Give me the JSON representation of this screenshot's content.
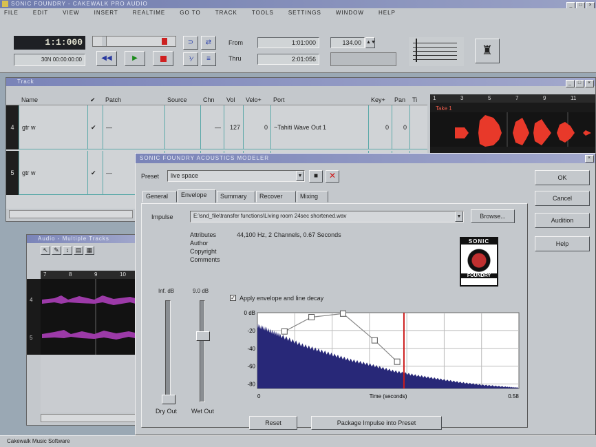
{
  "app": {
    "title": "SONIC FOUNDRY - CAKEWALK PRO AUDIO",
    "menu": [
      "File",
      "Edit",
      "View",
      "Insert",
      "Realtime",
      "Go To",
      "Track",
      "Tools",
      "Settings",
      "Window",
      "Help"
    ]
  },
  "transport": {
    "now_time": "1:1:000",
    "smpte": "30N  00:00:00:00",
    "from_label": "From",
    "from_value": "1:01:000",
    "thru_label": "Thru",
    "thru_value": "2:01:056",
    "tempo": "134.00"
  },
  "track_view": {
    "title": "Track",
    "columns": [
      "Name",
      "✔",
      "Patch",
      "Source",
      "Chn",
      "Vol",
      "Velo+",
      "Port",
      "Key+",
      "Pan",
      "Ti"
    ],
    "rows": [
      {
        "num": "4",
        "name": "gtr w",
        "check": "✔",
        "patch": "—",
        "chn": "—",
        "vol": "127",
        "velo": "0",
        "port": "~Tahiti Wave Out 1",
        "key": "0",
        "pan": "0"
      },
      {
        "num": "5",
        "name": "gtr w",
        "check": "✔",
        "patch": "—",
        "chn": "",
        "vol": "",
        "velo": "",
        "port": "",
        "key": "",
        "pan": ""
      }
    ],
    "clip_label": "Take 1",
    "ruler": [
      "1",
      "3",
      "5",
      "7",
      "9",
      "11"
    ]
  },
  "audio_view": {
    "title": "Audio - Multiple Tracks",
    "ruler": [
      "7",
      "8",
      "9",
      "10"
    ],
    "track_labels": [
      "4",
      "5"
    ]
  },
  "dialog": {
    "title": "Sonic Foundry Acoustics Modeler",
    "preset_label": "Preset",
    "preset_value": "live space",
    "tabs": [
      "General",
      "Envelope",
      "Summary",
      "Recover",
      "Mixing"
    ],
    "active_tab": "Envelope",
    "impulse_label": "Impulse",
    "impulse_path": "E:\\snd_file\\transfer functions\\Living room 24sec shortened.wav",
    "browse": "Browse...",
    "attributes_label": "Attributes",
    "attributes_value": "44,100 Hz, 2 Channels, 0.67 Seconds",
    "author_label": "Author",
    "copyright_label": "Copyright",
    "comments_label": "Comments",
    "dry_db": "Inf. dB",
    "wet_db": "9.0 dB",
    "dry_label": "Dry Out",
    "wet_label": "Wet Out",
    "apply_label": "Apply envelope and line decay",
    "apply_checked": true,
    "reset": "Reset",
    "package": "Package Impulse into Preset",
    "ok": "OK",
    "cancel": "Cancel",
    "audition": "Audition",
    "help": "Help",
    "logo_top": "SONIC",
    "logo_bottom": "FOUNDRY"
  },
  "chart_data": {
    "type": "area",
    "title": "",
    "xlabel": "Time (seconds)",
    "ylabel": "",
    "x_tick_labels": [
      "0",
      "0.58"
    ],
    "y_tick_labels": [
      "0 dB",
      "-20",
      "-40",
      "-60",
      "-80"
    ],
    "xlim": [
      0,
      0.58
    ],
    "ylim": [
      -85,
      0
    ],
    "grid": true,
    "colors": {
      "waveform": "#282878",
      "envelope": "#888888",
      "marker": "#cc1c1c"
    },
    "waveform_envelope_db": [
      {
        "x": 0.0,
        "y": -14
      },
      {
        "x": 0.02,
        "y": -18
      },
      {
        "x": 0.05,
        "y": -25
      },
      {
        "x": 0.1,
        "y": -36
      },
      {
        "x": 0.15,
        "y": -44
      },
      {
        "x": 0.2,
        "y": -52
      },
      {
        "x": 0.25,
        "y": -58
      },
      {
        "x": 0.3,
        "y": -65
      },
      {
        "x": 0.35,
        "y": -70
      },
      {
        "x": 0.4,
        "y": -74
      },
      {
        "x": 0.45,
        "y": -78
      },
      {
        "x": 0.5,
        "y": -81
      },
      {
        "x": 0.55,
        "y": -83
      },
      {
        "x": 0.58,
        "y": -84
      }
    ],
    "envelope_points": [
      {
        "x": 0.06,
        "y": -21
      },
      {
        "x": 0.12,
        "y": -5
      },
      {
        "x": 0.19,
        "y": -1
      },
      {
        "x": 0.26,
        "y": -31
      },
      {
        "x": 0.31,
        "y": -55
      }
    ],
    "marker_x": 0.325
  }
}
